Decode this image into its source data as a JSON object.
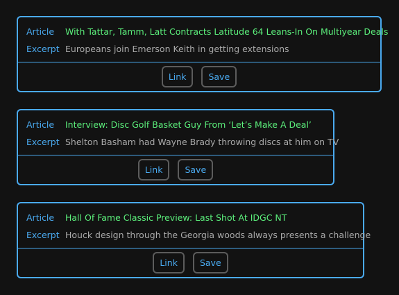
{
  "articles": [
    {
      "article_label": "Article",
      "title": "With Tattar, Tamm, Latt Contracts Latitude 64 Leans-In On Multiyear Deals",
      "excerpt_label": "Excerpt",
      "excerpt": "Europeans join Emerson Keith in getting extensions",
      "link_label": "Link",
      "save_label": "Save"
    },
    {
      "article_label": "Article",
      "title": "Interview: Disc Golf Basket Guy From ‘Let’s Make A Deal’",
      "excerpt_label": "Excerpt",
      "excerpt": "Shelton Basham had Wayne Brady throwing discs at him on TV",
      "link_label": "Link",
      "save_label": "Save"
    },
    {
      "article_label": "Article",
      "title": "Hall Of Fame Classic Preview: Last Shot At IDGC NT",
      "excerpt_label": "Excerpt",
      "excerpt": "Houck design through the Georgia woods always presents a challenge",
      "link_label": "Link",
      "save_label": "Save"
    }
  ],
  "colors": {
    "background": "#121212",
    "accent": "#4aaaf0",
    "title": "#5cf07c",
    "excerpt": "#a9a9a9",
    "button_border": "#5c5c5c"
  }
}
